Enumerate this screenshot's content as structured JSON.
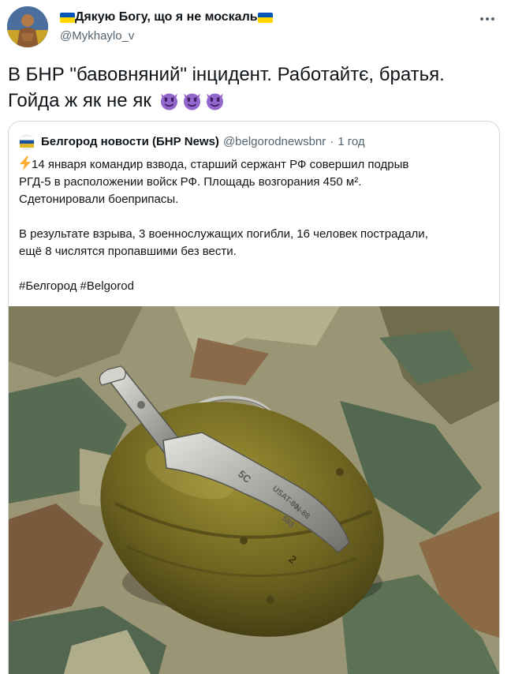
{
  "tweet": {
    "author_name": "Дякую Богу, що я не москаль",
    "author_handle": "@Mykhaylo_v",
    "text_line1": "В БНР \"бавовняний\" інцидент. Работайтє, братья.",
    "text_line2": "Гойда ж як не як",
    "flag_colors": [
      "#0057b7",
      "#ffd700"
    ],
    "emoji": [
      "smiling-imp-icon",
      "smiling-imp-icon",
      "smiling-imp-icon"
    ]
  },
  "quote": {
    "source_name": "Белгород новости (БНР News)",
    "source_handle": "@belgorodnewsbnr",
    "separator": "·",
    "time": "1 год",
    "line1": "14 января командир взвода, старший сержант РФ совершил подрыв",
    "line2": "РГД-5 в расположении войск РФ. Площадь возгорания 450 м².",
    "line3": "Сдетонировали боеприпасы.",
    "line4": "В результате взрыва, 3 военнослужащих погибли, 16 человек пострадали,",
    "line5": "ещё 8 числятся пропавшими без вести.",
    "hashtags": "#Белгород #Belgorod",
    "image_markings_1": "5С",
    "image_markings_2": "USAT-80",
    "image_markings_3": "N-88",
    "image_markings_4": "583"
  }
}
